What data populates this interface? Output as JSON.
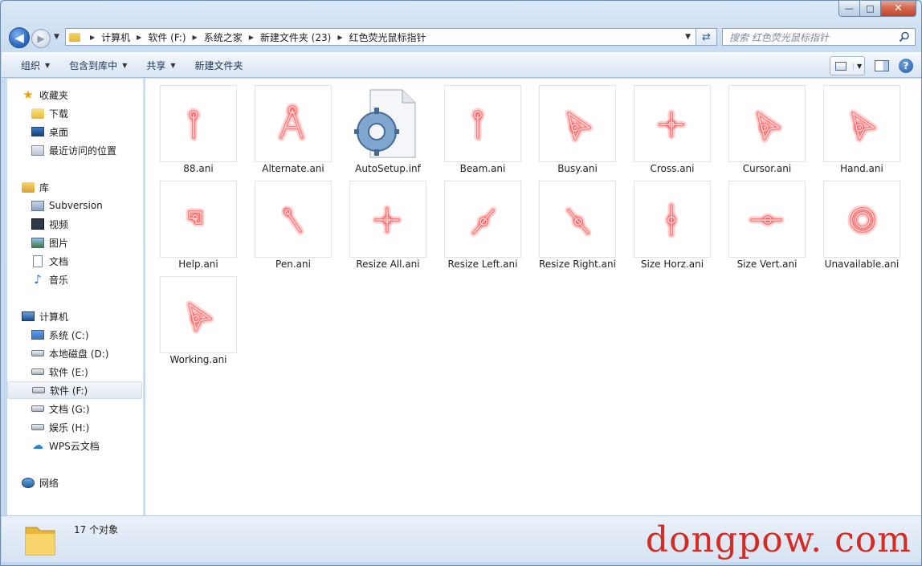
{
  "window": {
    "caption_min": "—",
    "caption_max": "□",
    "caption_close": "✕"
  },
  "address": {
    "crumbs": [
      "计算机",
      "软件 (F:)",
      "系统之家",
      "新建文件夹 (23)",
      "红色荧光鼠标指针"
    ]
  },
  "search": {
    "placeholder": "搜索 红色荧光鼠标指针"
  },
  "toolbar": {
    "organize": "组织",
    "include_library": "包含到库中",
    "share": "共享",
    "new_folder": "新建文件夹",
    "help": "?"
  },
  "nav": {
    "favorites": {
      "label": "收藏夹",
      "items": [
        "下载",
        "桌面",
        "最近访问的位置"
      ]
    },
    "libraries": {
      "label": "库",
      "items": [
        "Subversion",
        "视频",
        "图片",
        "文档",
        "音乐"
      ]
    },
    "computer": {
      "label": "计算机",
      "items": [
        "系统 (C:)",
        "本地磁盘 (D:)",
        "软件 (E:)",
        "软件 (F:)",
        "文档 (G:)",
        "娱乐 (H:)",
        "WPS云文档"
      ]
    },
    "network": {
      "label": "网络"
    },
    "selected": "软件 (F:)"
  },
  "files": [
    {
      "name": "88.ani",
      "cursor": "beam"
    },
    {
      "name": "Alternate.ani",
      "cursor": "alternate"
    },
    {
      "name": "AutoSetup.inf",
      "cursor": "inf"
    },
    {
      "name": "Beam.ani",
      "cursor": "beam"
    },
    {
      "name": "Busy.ani",
      "cursor": "arrow"
    },
    {
      "name": "Cross.ani",
      "cursor": "cross"
    },
    {
      "name": "Cursor.ani",
      "cursor": "arrow"
    },
    {
      "name": "Hand.ani",
      "cursor": "arrow"
    },
    {
      "name": "Help.ani",
      "cursor": "help"
    },
    {
      "name": "Pen.ani",
      "cursor": "pen"
    },
    {
      "name": "Resize All.ani",
      "cursor": "cross"
    },
    {
      "name": "Resize Left.ani",
      "cursor": "diag-left"
    },
    {
      "name": "Resize Right.ani",
      "cursor": "diag-right"
    },
    {
      "name": "Size Horz.ani",
      "cursor": "vertical"
    },
    {
      "name": "Size Vert.ani",
      "cursor": "horizontal"
    },
    {
      "name": "Unavailable.ani",
      "cursor": "ring"
    },
    {
      "name": "Working.ani",
      "cursor": "arrow"
    }
  ],
  "status": {
    "count": "17 个对象"
  },
  "watermark": "dongpow. com",
  "colors": {
    "glow": "#ff3b3b",
    "watermark": "#d42b24"
  }
}
